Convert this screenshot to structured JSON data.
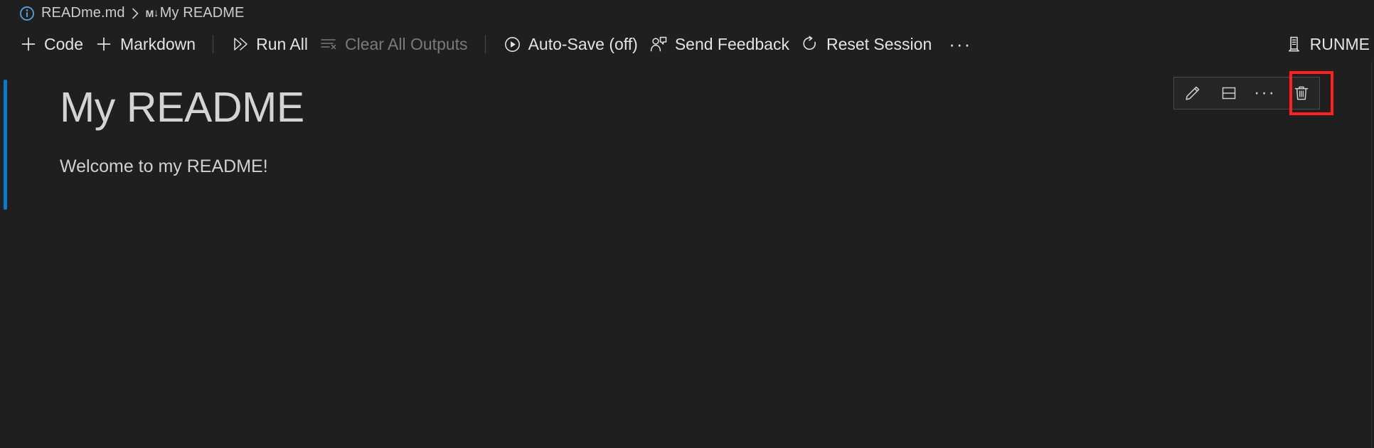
{
  "window": {
    "background_color": "#1f1f1f",
    "accent_color": "#0a7aca",
    "highlight_color": "#ff2020"
  },
  "breadcrumb": {
    "info_icon": "info-circle-icon",
    "separator": "chevron-right-icon",
    "items": [
      {
        "label": "READme.md",
        "icon": "info-circle-icon"
      },
      {
        "label": "My README",
        "icon": "markdown-icon",
        "icon_text": "M",
        "icon_arrow": "↓"
      }
    ]
  },
  "toolbar": {
    "buttons": [
      {
        "label": "Code",
        "icon": "plus-icon",
        "enabled": true
      },
      {
        "label": "Markdown",
        "icon": "plus-icon",
        "enabled": true
      },
      {
        "label": "Run All",
        "icon": "run-all-icon",
        "enabled": true
      },
      {
        "label": "Clear All Outputs",
        "icon": "clear-outputs-icon",
        "enabled": false
      },
      {
        "label": "Auto-Save (off)",
        "icon": "play-circle-icon",
        "enabled": true
      },
      {
        "label": "Send Feedback",
        "icon": "person-feedback-icon",
        "enabled": true
      },
      {
        "label": "Reset Session",
        "icon": "refresh-icon",
        "enabled": true
      }
    ],
    "overflow_label": "···",
    "kernel": {
      "label": "RUNME",
      "icon": "server-environment-icon"
    }
  },
  "notebook": {
    "cell": {
      "type": "markdown",
      "selected": true,
      "heading": "My README",
      "paragraph": "Welcome to my README!",
      "toolbar": {
        "buttons": [
          {
            "name": "edit-cell",
            "icon": "pencil-icon"
          },
          {
            "name": "split-cell",
            "icon": "split-cell-icon"
          },
          {
            "name": "more-actions",
            "icon": "ellipsis-icon",
            "label": "···"
          },
          {
            "name": "delete-cell",
            "icon": "trash-icon",
            "highlighted": true
          }
        ]
      }
    }
  }
}
